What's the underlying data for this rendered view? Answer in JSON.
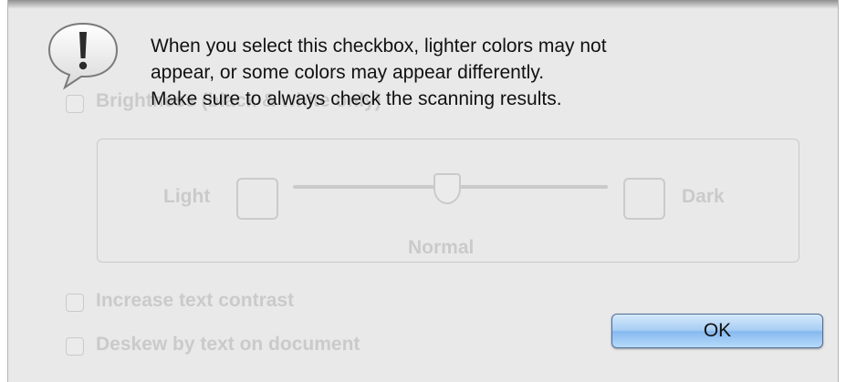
{
  "alert": {
    "message_lines": [
      "When you select this checkbox, lighter colors may not",
      "appear, or some colors may appear differently.",
      "Make sure to always check the scanning results."
    ],
    "ok_label": "OK",
    "icon": "exclamation-speech-bubble-icon"
  },
  "background_panel": {
    "brightness_checkbox_label": "Brightness (black & white only)",
    "slider_left_label": "Light",
    "slider_right_label": "Dark",
    "slider_center_label": "Normal",
    "increase_contrast_label": "Increase text contrast",
    "deskew_label": "Deskew by text on document"
  },
  "colors": {
    "dialog_background": "#e9e9e9",
    "ok_button_blue": "#9fc8f2"
  }
}
